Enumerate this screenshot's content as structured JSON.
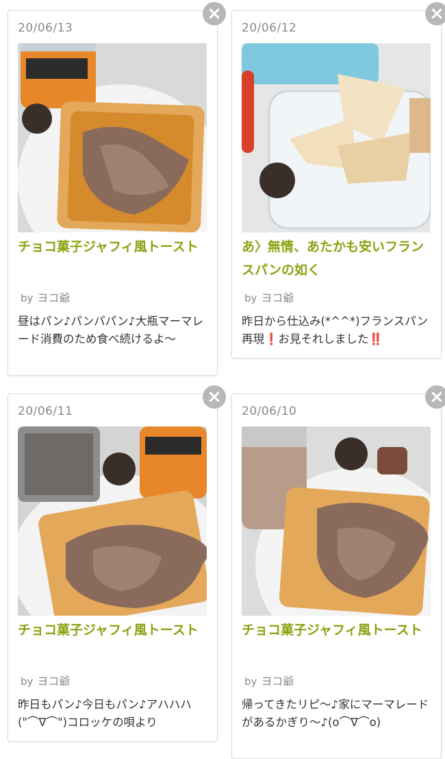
{
  "cards": [
    {
      "date": "20/06/13",
      "title": "チョコ菓子ジャフィ風トースト",
      "by_label": "by",
      "author": "ヨコ爺",
      "description": "昼はパン♪パンパパン♪大瓶マーマレード消費のため食べ続けるよ〜",
      "image_alt": "chocolate-marmalade-toast-photo"
    },
    {
      "date": "20/06/12",
      "title": "あ〉無情、あたかも安いフランスパンの如く",
      "by_label": "by",
      "author": "ヨコ爺",
      "description": "昨日から仕込み(*^^*)フランスパン再現❗お見それしました‼️",
      "image_alt": "french-bread-in-container-photo"
    },
    {
      "date": "20/06/11",
      "title": "チョコ菓子ジャフィ風トースト",
      "by_label": "by",
      "author": "ヨコ爺",
      "description": "昨日もパン♪今日もパン♪アハハハ(\"⌒∇⌒\")コロッケの唄より",
      "image_alt": "chocolate-marmalade-toast-photo"
    },
    {
      "date": "20/06/10",
      "title": "チョコ菓子ジャフィ風トースト",
      "by_label": "by",
      "author": "ヨコ爺",
      "description": "帰ってきたリピ〜♪家にマーマレードがあるかぎり〜♪(o⌒∇⌒o)",
      "image_alt": "chocolate-marmalade-toast-photo"
    }
  ],
  "close_icon": "×",
  "colors": {
    "title": "#8aa312",
    "muted": "#888888",
    "close_bg": "#b7b7b7"
  }
}
